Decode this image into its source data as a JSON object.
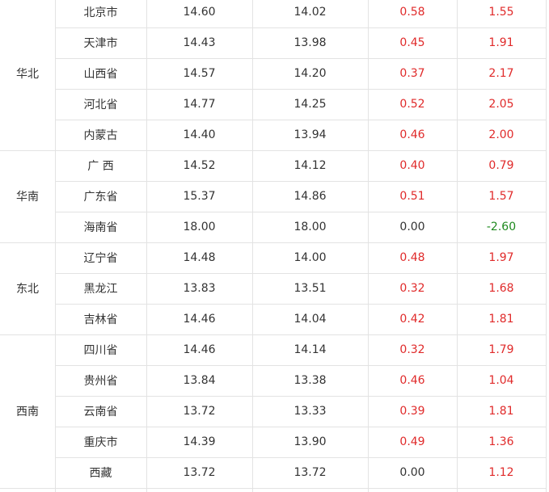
{
  "table": {
    "groups": [
      {
        "region": "华北",
        "rows": [
          {
            "province": "北京市",
            "v1": "14.60",
            "v2": "14.02",
            "diff": "0.58",
            "change": "1.55"
          },
          {
            "province": "天津市",
            "v1": "14.43",
            "v2": "13.98",
            "diff": "0.45",
            "change": "1.91"
          },
          {
            "province": "山西省",
            "v1": "14.57",
            "v2": "14.20",
            "diff": "0.37",
            "change": "2.17"
          },
          {
            "province": "河北省",
            "v1": "14.77",
            "v2": "14.25",
            "diff": "0.52",
            "change": "2.05"
          },
          {
            "province": "内蒙古",
            "v1": "14.40",
            "v2": "13.94",
            "diff": "0.46",
            "change": "2.00"
          }
        ]
      },
      {
        "region": "华南",
        "rows": [
          {
            "province": "广 西",
            "v1": "14.52",
            "v2": "14.12",
            "diff": "0.40",
            "change": "0.79"
          },
          {
            "province": "广东省",
            "v1": "15.37",
            "v2": "14.86",
            "diff": "0.51",
            "change": "1.57"
          },
          {
            "province": "海南省",
            "v1": "18.00",
            "v2": "18.00",
            "diff": "0.00",
            "change": "-2.60"
          }
        ]
      },
      {
        "region": "东北",
        "rows": [
          {
            "province": "辽宁省",
            "v1": "14.48",
            "v2": "14.00",
            "diff": "0.48",
            "change": "1.97"
          },
          {
            "province": "黑龙江",
            "v1": "13.83",
            "v2": "13.51",
            "diff": "0.32",
            "change": "1.68"
          },
          {
            "province": "吉林省",
            "v1": "14.46",
            "v2": "14.04",
            "diff": "0.42",
            "change": "1.81"
          }
        ]
      },
      {
        "region": "西南",
        "rows": [
          {
            "province": "四川省",
            "v1": "14.46",
            "v2": "14.14",
            "diff": "0.32",
            "change": "1.79"
          },
          {
            "province": "贵州省",
            "v1": "13.84",
            "v2": "13.38",
            "diff": "0.46",
            "change": "1.04"
          },
          {
            "province": "云南省",
            "v1": "13.72",
            "v2": "13.33",
            "diff": "0.39",
            "change": "1.81"
          },
          {
            "province": "重庆市",
            "v1": "14.39",
            "v2": "13.90",
            "diff": "0.49",
            "change": "1.36"
          },
          {
            "province": "西藏",
            "v1": "13.72",
            "v2": "13.72",
            "diff": "0.00",
            "change": "1.12"
          }
        ]
      }
    ],
    "colors": {
      "positive": "#e02a2a",
      "negative": "#1f8a1f",
      "neutral": "#333333",
      "grid": "#e3e3e3"
    }
  }
}
